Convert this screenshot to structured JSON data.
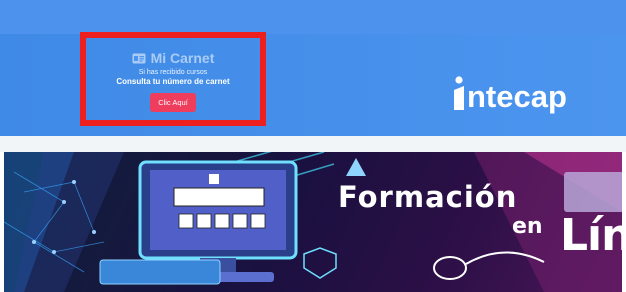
{
  "card": {
    "title": "Mi Carnet",
    "subtitle": "Si has recibido cursos",
    "cta": "Consulta tu número de carnet",
    "button_label": "Clic Aquí"
  },
  "logo": {
    "text": "ntecap"
  },
  "banner": {
    "line1": "Formación",
    "line2": "en",
    "line3": "Lín"
  },
  "colors": {
    "header_blue": "#4a93ee",
    "highlight_red": "#ee1f1f",
    "button_pink": "#ef3d5d"
  }
}
